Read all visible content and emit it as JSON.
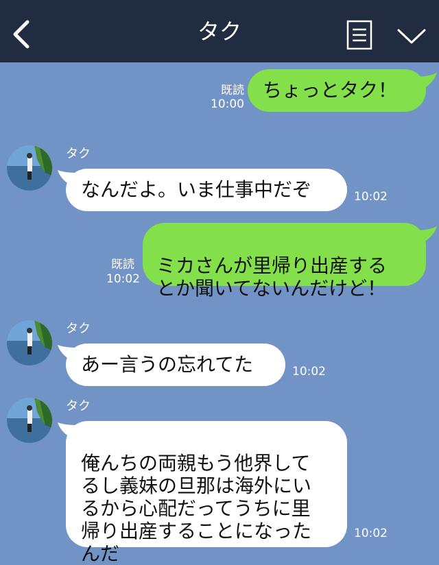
{
  "header": {
    "title": "タク",
    "back_icon": "chevron-left-icon",
    "menu_icon": "menu-list-icon",
    "dropdown_icon": "chevron-down-icon",
    "background": "#222c41"
  },
  "colors": {
    "chat_background": "#7293c5",
    "outgoing_bubble": "#83e04a",
    "incoming_bubble": "#ffffff"
  },
  "messages": [
    {
      "sender": "me",
      "text": "ちょっとタク！",
      "read": "既読",
      "time": "10:00"
    },
    {
      "sender": "タク",
      "text": "なんだよ。いま仕事中だぞ",
      "time": "10:02"
    },
    {
      "sender": "me",
      "text": "ミカさんが里帰り出産する\nとか聞いてないんだけど！",
      "read": "既読",
      "time": "10:02"
    },
    {
      "sender": "タク",
      "text": "あー言うの忘れてた",
      "time": "10:02"
    },
    {
      "sender": "タク",
      "text": "俺んちの両親もう他界して\nるし義妹の旦那は海外にい\nるから心配だってうちに里\n帰り出産することになった\nんだ",
      "time": "10:02"
    }
  ]
}
